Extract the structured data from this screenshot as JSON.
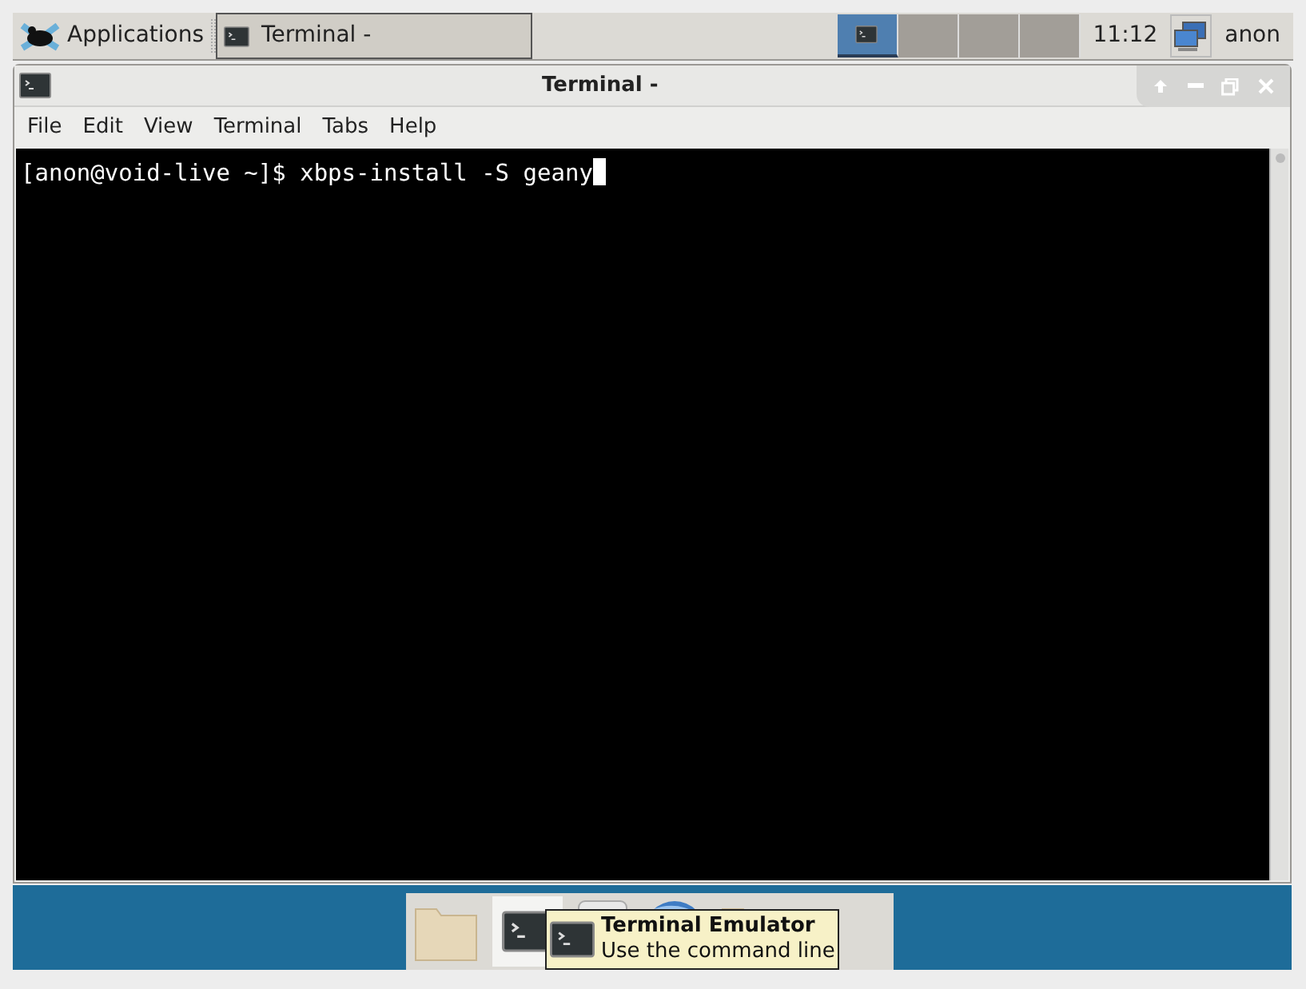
{
  "top_panel": {
    "applications_label": "Applications",
    "tasks": [
      {
        "label": "Terminal -",
        "selected": true
      }
    ],
    "workspaces": [
      {
        "selected": true
      },
      {
        "selected": false
      },
      {
        "selected": false
      },
      {
        "selected": false
      }
    ],
    "clock": "11:12",
    "user": "anon"
  },
  "window": {
    "title": "Terminal -",
    "menu": [
      "File",
      "Edit",
      "View",
      "Terminal",
      "Tabs",
      "Help"
    ],
    "prompt": "[anon@void-live ~]$ xbps-install -S geany"
  },
  "dock": {
    "items": [
      {
        "kind": "folder"
      },
      {
        "kind": "terminal"
      },
      {
        "kind": "disk"
      },
      {
        "kind": "globe"
      },
      {
        "kind": "folder"
      }
    ]
  },
  "tooltip": {
    "title": "Terminal Emulator",
    "subtitle": "Use the command line"
  }
}
